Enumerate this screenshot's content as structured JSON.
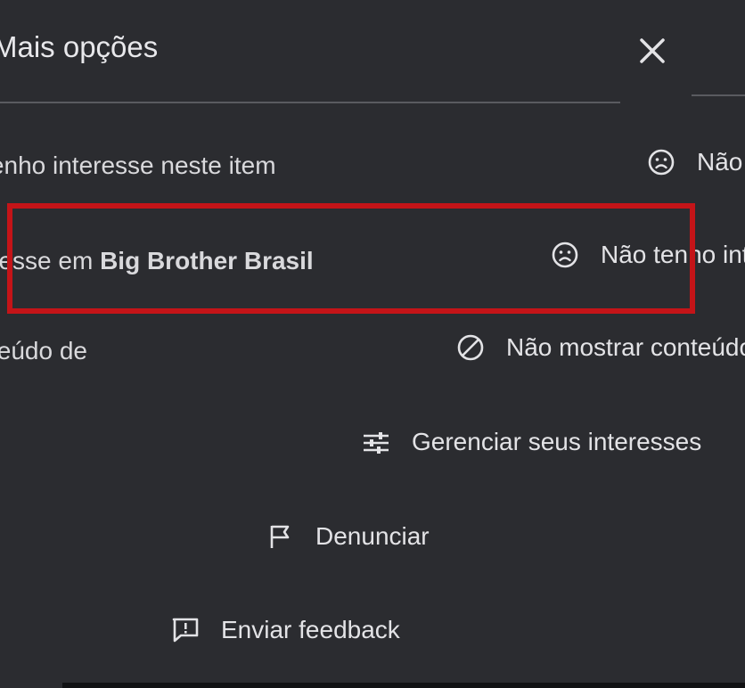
{
  "header": {
    "title": "Mais opções",
    "close_icon": "close-icon"
  },
  "menu": {
    "items": [
      {
        "label": "Não tenho interesse neste item",
        "icon": "sad-face-icon"
      },
      {
        "label_prefix": "Não tenho interesse em ",
        "label_bold": "Big Brother Brasil",
        "icon": "sad-face-icon"
      },
      {
        "label": "Não mostrar conteúdo de",
        "icon": "block-icon"
      },
      {
        "label": "Gerenciar seus interesses",
        "icon": "sliders-icon"
      },
      {
        "label": "Denunciar",
        "icon": "flag-icon"
      },
      {
        "label": "Enviar feedback",
        "icon": "feedback-icon"
      }
    ]
  },
  "highlight": {
    "color": "#c41418"
  },
  "colors": {
    "background": "#2b2c30",
    "text": "#e3e3e6"
  }
}
